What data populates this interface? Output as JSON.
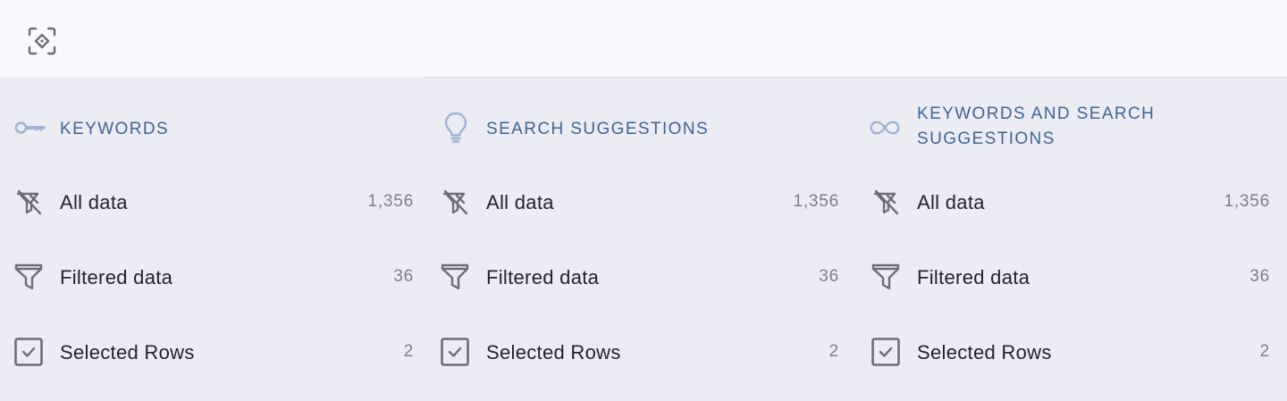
{
  "toolbar": {
    "focus_icon": "focus-target-icon"
  },
  "colors": {
    "header_text": "#3f6496",
    "header_icon": "#9db4d3",
    "row_icon": "#6d6e74",
    "panel_bg": "#ececf5",
    "topbar_bg": "#f8f8fd"
  },
  "columns": [
    {
      "title": "Keywords",
      "icon": "key-icon",
      "rows": [
        {
          "label": "All data",
          "count": "1,356",
          "icon": "all-data-icon"
        },
        {
          "label": "Filtered data",
          "count": "36",
          "icon": "filter-icon"
        },
        {
          "label": "Selected Rows",
          "count": "2",
          "icon": "checkbox-icon"
        }
      ]
    },
    {
      "title": "Search Suggestions",
      "icon": "lightbulb-icon",
      "rows": [
        {
          "label": "All data",
          "count": "1,356",
          "icon": "all-data-icon"
        },
        {
          "label": "Filtered data",
          "count": "36",
          "icon": "filter-icon"
        },
        {
          "label": "Selected Rows",
          "count": "2",
          "icon": "checkbox-icon"
        }
      ]
    },
    {
      "title": "Keywords and Search Suggestions",
      "icon": "infinity-icon",
      "rows": [
        {
          "label": "All data",
          "count": "1,356",
          "icon": "all-data-icon"
        },
        {
          "label": "Filtered data",
          "count": "36",
          "icon": "filter-icon"
        },
        {
          "label": "Selected Rows",
          "count": "2",
          "icon": "checkbox-icon"
        }
      ]
    }
  ]
}
